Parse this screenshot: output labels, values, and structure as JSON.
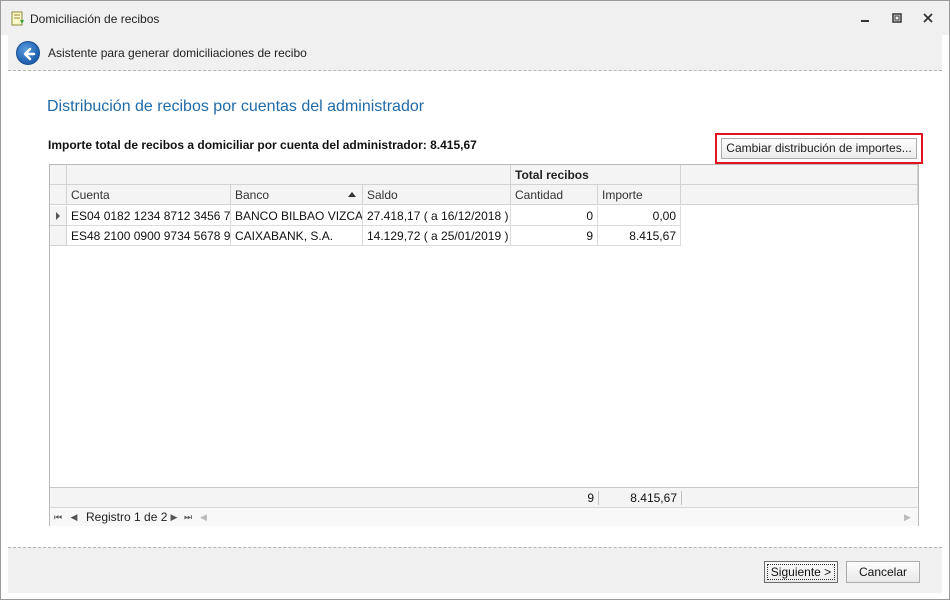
{
  "window": {
    "title": "Domiciliación de recibos",
    "controls": [
      "minimize-icon",
      "restore-icon",
      "close-icon"
    ]
  },
  "wizard": {
    "title": "Asistente para generar domiciliaciones de recibo"
  },
  "page": {
    "title": "Distribución de recibos por cuentas del administrador",
    "total_label": "Importe total de recibos a domiciliar por cuenta del administrador:",
    "total_value": "8.415,67",
    "change_button": "Cambiar distribución de importes..."
  },
  "grid": {
    "band_total": "Total recibos",
    "columns": {
      "cuenta": "Cuenta",
      "banco": "Banco",
      "saldo": "Saldo",
      "cantidad": "Cantidad",
      "importe": "Importe"
    },
    "rows": [
      {
        "cuenta": "ES04 0182 1234 8712 3456 7...",
        "banco": "BANCO BILBAO VIZCA...",
        "saldo": "27.418,17 ( a 16/12/2018 )",
        "cantidad": "0",
        "importe": "0,00"
      },
      {
        "cuenta": "ES48 2100 0900 9734 5678 9...",
        "banco": "CAIXABANK, S.A.",
        "saldo": "14.129,72 ( a 25/01/2019 )",
        "cantidad": "9",
        "importe": "8.415,67"
      }
    ],
    "footer": {
      "cantidad": "9",
      "importe": "8.415,67"
    },
    "navigator": {
      "text": "Registro 1 de 2"
    },
    "sort": {
      "column": "banco",
      "direction": "ascending"
    }
  },
  "buttons": {
    "next": "Siguiente >",
    "cancel": "Cancelar"
  },
  "colors": {
    "accent_title": "#1f6aa8",
    "highlight_frame": "#e0141e",
    "back_button": "#1e5fae"
  }
}
